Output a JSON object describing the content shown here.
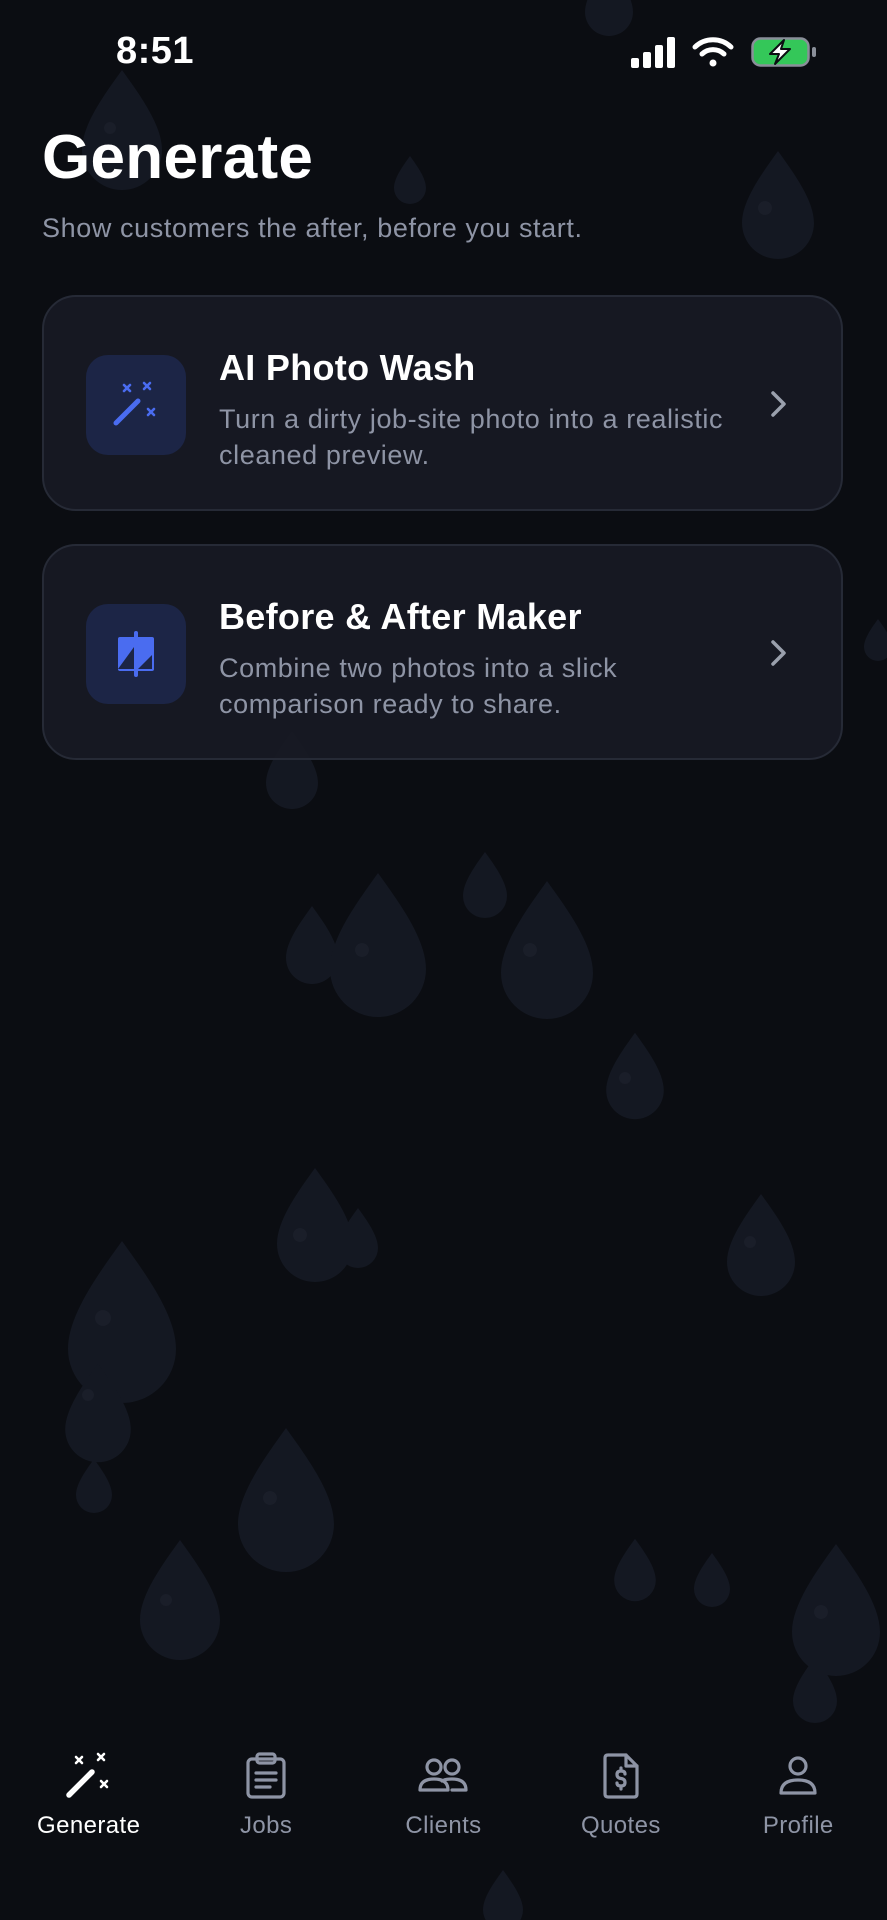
{
  "status_bar": {
    "time": "8:51"
  },
  "header": {
    "title": "Generate",
    "subtitle": "Show customers the after, before you start."
  },
  "cards": [
    {
      "title": "AI Photo Wash",
      "description": "Turn a dirty job-site photo into a realistic cleaned preview.",
      "icon": "magic-wand-icon"
    },
    {
      "title": "Before & After Maker",
      "description": "Combine two photos into a slick comparison ready to share.",
      "icon": "compare-icon"
    }
  ],
  "tab_bar": {
    "active": "Generate",
    "tabs": [
      {
        "label": "Generate",
        "icon": "magic-wand-icon"
      },
      {
        "label": "Jobs",
        "icon": "clipboard-icon"
      },
      {
        "label": "Clients",
        "icon": "users-icon"
      },
      {
        "label": "Quotes",
        "icon": "invoice-icon"
      },
      {
        "label": "Profile",
        "icon": "user-icon"
      }
    ]
  },
  "colors": {
    "background": "#0b0d12",
    "card": "#171a23",
    "accent": "#4a6cf0",
    "battery": "#34c759",
    "muted_text": "#8e94a5"
  }
}
